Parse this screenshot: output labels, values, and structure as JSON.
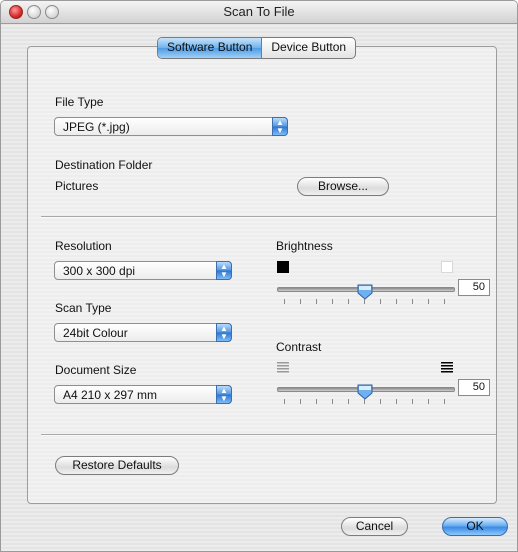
{
  "window": {
    "title": "Scan To File"
  },
  "tabs": [
    {
      "label": "Software Button",
      "selected": true
    },
    {
      "label": "Device Button",
      "selected": false
    }
  ],
  "file_type": {
    "label": "File Type",
    "value": "JPEG (*.jpg)"
  },
  "destination": {
    "label": "Destination Folder",
    "value": "Pictures",
    "browse_label": "Browse..."
  },
  "resolution": {
    "label": "Resolution",
    "value": "300 x 300 dpi"
  },
  "scan_type": {
    "label": "Scan Type",
    "value": "24bit Colour"
  },
  "document_size": {
    "label": "Document Size",
    "value": "A4 210 x 297 mm"
  },
  "brightness": {
    "label": "Brightness",
    "value": "50",
    "level": 0.5,
    "min_icon": "black-square-icon",
    "max_icon": "white-square-icon"
  },
  "contrast": {
    "label": "Contrast",
    "value": "50",
    "level": 0.5,
    "min_icon": "low-contrast-lines-icon",
    "max_icon": "high-contrast-lines-icon"
  },
  "buttons": {
    "restore_defaults": "Restore Defaults",
    "cancel": "Cancel",
    "ok": "OK"
  },
  "colors": {
    "accent_blue": "#4f9be3",
    "window_bg": "#e8e8e8"
  }
}
